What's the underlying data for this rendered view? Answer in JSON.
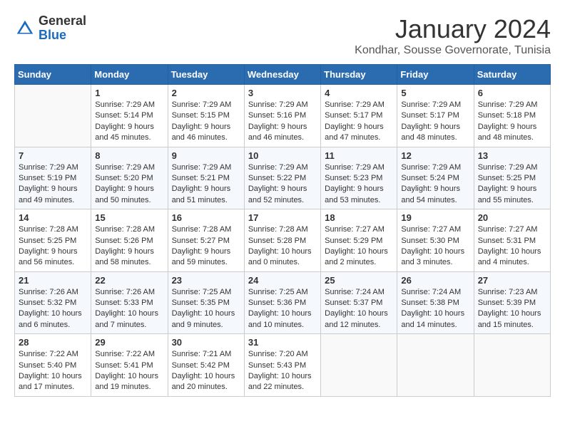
{
  "header": {
    "logo_general": "General",
    "logo_blue": "Blue",
    "month_title": "January 2024",
    "subtitle": "Kondhar, Sousse Governorate, Tunisia"
  },
  "weekdays": [
    "Sunday",
    "Monday",
    "Tuesday",
    "Wednesday",
    "Thursday",
    "Friday",
    "Saturday"
  ],
  "weeks": [
    [
      {
        "day": "",
        "lines": []
      },
      {
        "day": "1",
        "lines": [
          "Sunrise: 7:29 AM",
          "Sunset: 5:14 PM",
          "Daylight: 9 hours",
          "and 45 minutes."
        ]
      },
      {
        "day": "2",
        "lines": [
          "Sunrise: 7:29 AM",
          "Sunset: 5:15 PM",
          "Daylight: 9 hours",
          "and 46 minutes."
        ]
      },
      {
        "day": "3",
        "lines": [
          "Sunrise: 7:29 AM",
          "Sunset: 5:16 PM",
          "Daylight: 9 hours",
          "and 46 minutes."
        ]
      },
      {
        "day": "4",
        "lines": [
          "Sunrise: 7:29 AM",
          "Sunset: 5:17 PM",
          "Daylight: 9 hours",
          "and 47 minutes."
        ]
      },
      {
        "day": "5",
        "lines": [
          "Sunrise: 7:29 AM",
          "Sunset: 5:17 PM",
          "Daylight: 9 hours",
          "and 48 minutes."
        ]
      },
      {
        "day": "6",
        "lines": [
          "Sunrise: 7:29 AM",
          "Sunset: 5:18 PM",
          "Daylight: 9 hours",
          "and 48 minutes."
        ]
      }
    ],
    [
      {
        "day": "7",
        "lines": [
          "Sunrise: 7:29 AM",
          "Sunset: 5:19 PM",
          "Daylight: 9 hours",
          "and 49 minutes."
        ]
      },
      {
        "day": "8",
        "lines": [
          "Sunrise: 7:29 AM",
          "Sunset: 5:20 PM",
          "Daylight: 9 hours",
          "and 50 minutes."
        ]
      },
      {
        "day": "9",
        "lines": [
          "Sunrise: 7:29 AM",
          "Sunset: 5:21 PM",
          "Daylight: 9 hours",
          "and 51 minutes."
        ]
      },
      {
        "day": "10",
        "lines": [
          "Sunrise: 7:29 AM",
          "Sunset: 5:22 PM",
          "Daylight: 9 hours",
          "and 52 minutes."
        ]
      },
      {
        "day": "11",
        "lines": [
          "Sunrise: 7:29 AM",
          "Sunset: 5:23 PM",
          "Daylight: 9 hours",
          "and 53 minutes."
        ]
      },
      {
        "day": "12",
        "lines": [
          "Sunrise: 7:29 AM",
          "Sunset: 5:24 PM",
          "Daylight: 9 hours",
          "and 54 minutes."
        ]
      },
      {
        "day": "13",
        "lines": [
          "Sunrise: 7:29 AM",
          "Sunset: 5:25 PM",
          "Daylight: 9 hours",
          "and 55 minutes."
        ]
      }
    ],
    [
      {
        "day": "14",
        "lines": [
          "Sunrise: 7:28 AM",
          "Sunset: 5:25 PM",
          "Daylight: 9 hours",
          "and 56 minutes."
        ]
      },
      {
        "day": "15",
        "lines": [
          "Sunrise: 7:28 AM",
          "Sunset: 5:26 PM",
          "Daylight: 9 hours",
          "and 58 minutes."
        ]
      },
      {
        "day": "16",
        "lines": [
          "Sunrise: 7:28 AM",
          "Sunset: 5:27 PM",
          "Daylight: 9 hours",
          "and 59 minutes."
        ]
      },
      {
        "day": "17",
        "lines": [
          "Sunrise: 7:28 AM",
          "Sunset: 5:28 PM",
          "Daylight: 10 hours",
          "and 0 minutes."
        ]
      },
      {
        "day": "18",
        "lines": [
          "Sunrise: 7:27 AM",
          "Sunset: 5:29 PM",
          "Daylight: 10 hours",
          "and 2 minutes."
        ]
      },
      {
        "day": "19",
        "lines": [
          "Sunrise: 7:27 AM",
          "Sunset: 5:30 PM",
          "Daylight: 10 hours",
          "and 3 minutes."
        ]
      },
      {
        "day": "20",
        "lines": [
          "Sunrise: 7:27 AM",
          "Sunset: 5:31 PM",
          "Daylight: 10 hours",
          "and 4 minutes."
        ]
      }
    ],
    [
      {
        "day": "21",
        "lines": [
          "Sunrise: 7:26 AM",
          "Sunset: 5:32 PM",
          "Daylight: 10 hours",
          "and 6 minutes."
        ]
      },
      {
        "day": "22",
        "lines": [
          "Sunrise: 7:26 AM",
          "Sunset: 5:33 PM",
          "Daylight: 10 hours",
          "and 7 minutes."
        ]
      },
      {
        "day": "23",
        "lines": [
          "Sunrise: 7:25 AM",
          "Sunset: 5:35 PM",
          "Daylight: 10 hours",
          "and 9 minutes."
        ]
      },
      {
        "day": "24",
        "lines": [
          "Sunrise: 7:25 AM",
          "Sunset: 5:36 PM",
          "Daylight: 10 hours",
          "and 10 minutes."
        ]
      },
      {
        "day": "25",
        "lines": [
          "Sunrise: 7:24 AM",
          "Sunset: 5:37 PM",
          "Daylight: 10 hours",
          "and 12 minutes."
        ]
      },
      {
        "day": "26",
        "lines": [
          "Sunrise: 7:24 AM",
          "Sunset: 5:38 PM",
          "Daylight: 10 hours",
          "and 14 minutes."
        ]
      },
      {
        "day": "27",
        "lines": [
          "Sunrise: 7:23 AM",
          "Sunset: 5:39 PM",
          "Daylight: 10 hours",
          "and 15 minutes."
        ]
      }
    ],
    [
      {
        "day": "28",
        "lines": [
          "Sunrise: 7:22 AM",
          "Sunset: 5:40 PM",
          "Daylight: 10 hours",
          "and 17 minutes."
        ]
      },
      {
        "day": "29",
        "lines": [
          "Sunrise: 7:22 AM",
          "Sunset: 5:41 PM",
          "Daylight: 10 hours",
          "and 19 minutes."
        ]
      },
      {
        "day": "30",
        "lines": [
          "Sunrise: 7:21 AM",
          "Sunset: 5:42 PM",
          "Daylight: 10 hours",
          "and 20 minutes."
        ]
      },
      {
        "day": "31",
        "lines": [
          "Sunrise: 7:20 AM",
          "Sunset: 5:43 PM",
          "Daylight: 10 hours",
          "and 22 minutes."
        ]
      },
      {
        "day": "",
        "lines": []
      },
      {
        "day": "",
        "lines": []
      },
      {
        "day": "",
        "lines": []
      }
    ]
  ]
}
